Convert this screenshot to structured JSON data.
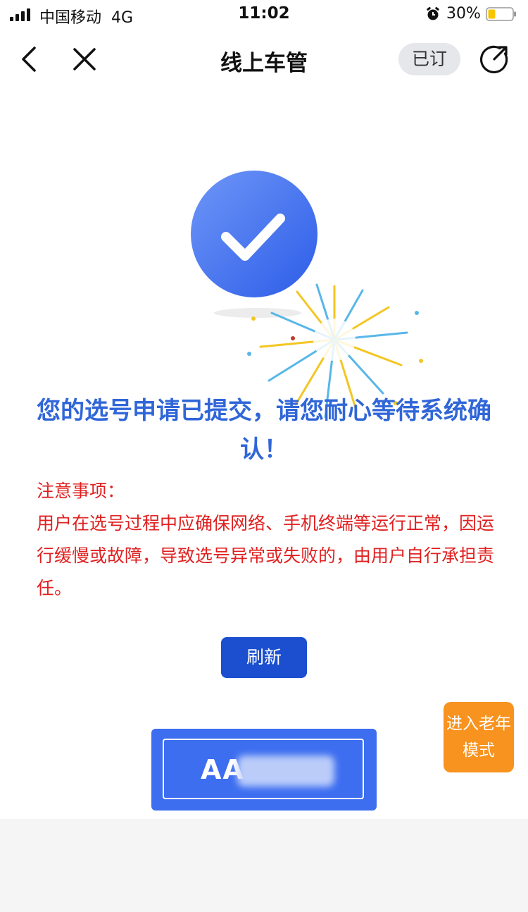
{
  "status_bar": {
    "carrier": "中国移动",
    "network": "4G",
    "time": "11:02",
    "battery_percent": "30%",
    "battery_level": 0.3,
    "battery_color": "#f7c600"
  },
  "nav": {
    "title": "线上车管",
    "subscribed_label": "已订",
    "back_icon": "chevron-left-icon",
    "close_icon": "close-icon",
    "share_icon": "share-icon"
  },
  "success": {
    "icon": "check-circle-icon",
    "headline": "您的选号申请已提交，请您耐心等待系统确认！"
  },
  "notice": {
    "title": "注意事项：",
    "body": "用户在选号过程中应确保网络、手机终端等运行正常，因运行缓慢或故障，导致选号异常或失败的，由用户自行承担责任。"
  },
  "refresh_label": "刷新",
  "elder_mode_label": "进入老年模式",
  "plate": {
    "visible_prefix": "AA"
  },
  "colors": {
    "primary_blue": "#3066d8",
    "button_blue": "#1b4fcf",
    "plate_blue": "#3d6ef0",
    "notice_red": "#e02020",
    "elder_orange": "#f7931e"
  }
}
